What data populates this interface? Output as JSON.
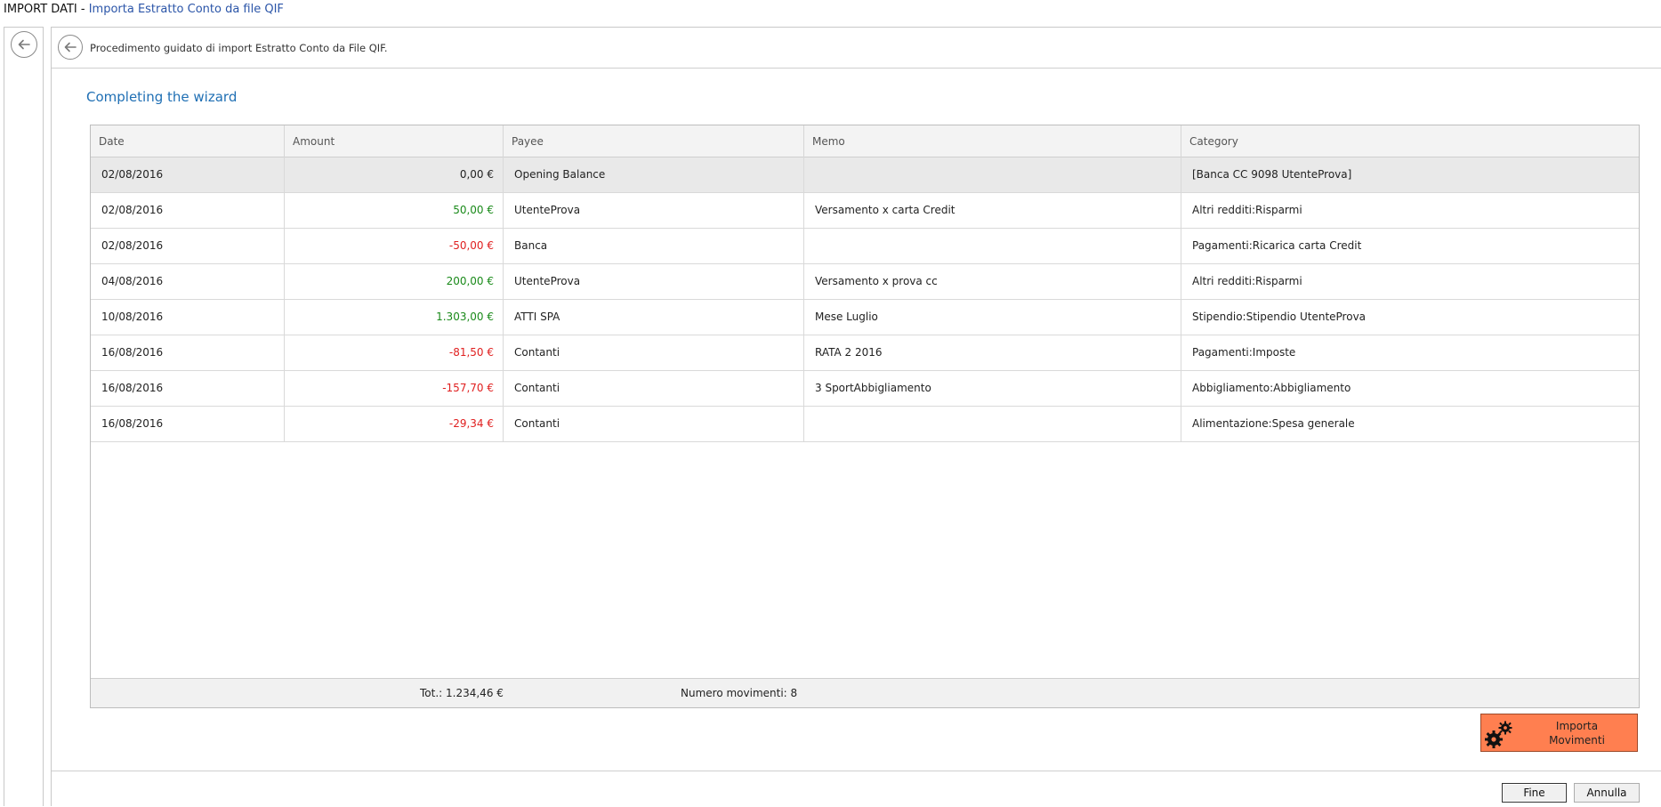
{
  "window": {
    "title_main": "IMPORT DATI",
    "title_sep": " - ",
    "title_sub": "Importa Estratto Conto da file QIF"
  },
  "wizard": {
    "description": "Procedimento guidato di import Estratto Conto da File QIF.",
    "page_title": "Completing the wizard"
  },
  "grid": {
    "columns": [
      "Date",
      "Amount",
      "Payee",
      "Memo",
      "Category"
    ],
    "rows": [
      {
        "date": "02/08/2016",
        "amount": "0,00 €",
        "sign": "zero",
        "payee": "Opening Balance",
        "memo": "",
        "category": "[Banca CC 9098 UtenteProva]",
        "selected": true
      },
      {
        "date": "02/08/2016",
        "amount": "50,00 €",
        "sign": "pos",
        "payee": "UtenteProva",
        "memo": "Versamento x carta Credit",
        "category": "Altri redditi:Risparmi"
      },
      {
        "date": "02/08/2016",
        "amount": "-50,00 €",
        "sign": "neg",
        "payee": "Banca",
        "memo": "",
        "category": "Pagamenti:Ricarica carta Credit"
      },
      {
        "date": "04/08/2016",
        "amount": "200,00 €",
        "sign": "pos",
        "payee": "UtenteProva",
        "memo": "Versamento x prova cc",
        "category": "Altri redditi:Risparmi"
      },
      {
        "date": "10/08/2016",
        "amount": "1.303,00 €",
        "sign": "pos",
        "payee": "ATTI SPA",
        "memo": "Mese Luglio",
        "category": "Stipendio:Stipendio UtenteProva"
      },
      {
        "date": "16/08/2016",
        "amount": "-81,50 €",
        "sign": "neg",
        "payee": "Contanti",
        "memo": "RATA 2 2016",
        "category": "Pagamenti:Imposte"
      },
      {
        "date": "16/08/2016",
        "amount": "-157,70 €",
        "sign": "neg",
        "payee": "Contanti",
        "memo": "3 SportAbbigliamento",
        "category": "Abbigliamento:Abbigliamento"
      },
      {
        "date": "16/08/2016",
        "amount": "-29,34 €",
        "sign": "neg",
        "payee": "Contanti",
        "memo": "",
        "category": "Alimentazione:Spesa generale"
      }
    ],
    "footer": {
      "total": "Tot.: 1.234,46 €",
      "count": "Numero movimenti: 8"
    }
  },
  "actions": {
    "import_line1": "Importa",
    "import_line2": "Movimenti",
    "finish": "Fine",
    "cancel": "Annulla"
  },
  "colors": {
    "positive": "#1a8a1a",
    "negative": "#e02020",
    "accent_title": "#1f6fb4",
    "import_button": "#ff7f50"
  },
  "icons": {
    "back": "arrow-left-circle-icon",
    "import": "gears-icon"
  }
}
